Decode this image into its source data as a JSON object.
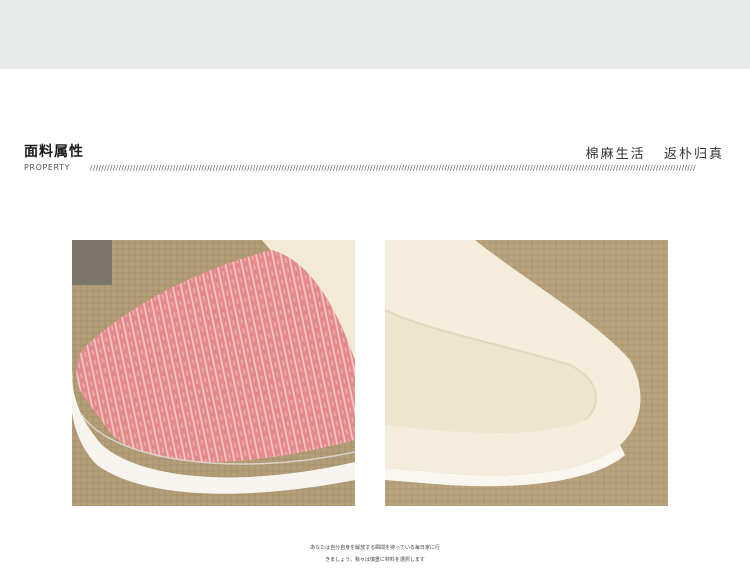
{
  "header": {
    "title_cn": "面料属性",
    "title_en": "PROPERTY",
    "slogan": "棉麻生活   返朴归真"
  },
  "divider": {
    "pattern": "////////////////////////////////////////////////////////////////////////////////////////////////////////////////////////////////////////////////////////////////////////////////////////////////////////////////////"
  },
  "photos": [
    {
      "subject": "pink knit slipper toe"
    },
    {
      "subject": "cream plush slipper interior"
    }
  ],
  "footnote": {
    "line1": "あなたは自分自身を解放する瞬間を待っている毎日家に行",
    "line2": "きましょう。我々は慎重に材料を選択します"
  },
  "colors": {
    "top_band": "#e8e9e9",
    "slipper_pink": "#e58a8c",
    "plush_cream": "#f3ecd9",
    "burlap": "#b5a07a"
  }
}
